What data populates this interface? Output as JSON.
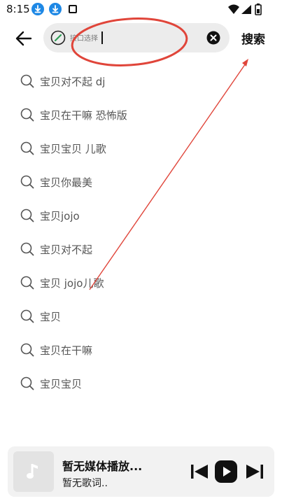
{
  "status_bar": {
    "time": "8:15"
  },
  "search": {
    "source_label": "接口选择",
    "value": "",
    "search_button_label": "搜索"
  },
  "suggestions": [
    "宝贝对不起 dj",
    "宝贝在干嘛 恐怖版",
    "宝贝宝贝 儿歌",
    "宝贝你最美",
    "宝贝jojo",
    "宝贝对不起",
    "宝贝 jojo儿歌",
    "宝贝",
    "宝贝在干嘛",
    "宝贝宝贝"
  ],
  "player": {
    "title": "暂无媒体播放...",
    "lyrics": "暂无歌词.."
  },
  "icons": {
    "back": "arrow-left-icon",
    "source": "link-icon",
    "clear": "close-circle-icon",
    "suggestion": "search-icon",
    "album": "music-note-icon",
    "prev": "skip-previous-icon",
    "play": "play-icon",
    "next": "skip-next-icon"
  },
  "colors": {
    "annotation_red": "#e0453a",
    "download_badge": "#1e88e5",
    "source_icon_green": "#2e9e56"
  }
}
